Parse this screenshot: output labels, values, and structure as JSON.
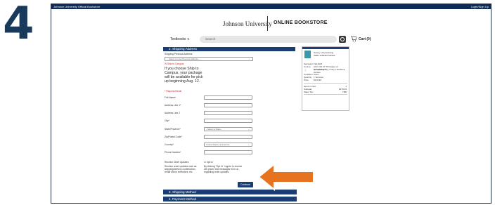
{
  "step_number": "4",
  "topbar": {
    "left": "Johnson University Official Bookstore",
    "right": "Login/Sign Up"
  },
  "header": {
    "university": "Johnson University",
    "store": "ONLINE BOOKSTORE"
  },
  "nav": {
    "textbooks": "Textbooks",
    "search_placeholder": "Search",
    "cart": "Cart (0)"
  },
  "shipping": {
    "heading": "2. Shipping Address",
    "prev_label": "Shipping Previous Address",
    "prev_select": "-- Select to Use Previous Address --",
    "ship_to_campus": "Ship to Campus",
    "campus_note": "If you choose Ship to Campus, your package will be available for pick up beginning Aug. 12.",
    "required": "* Required fields",
    "fields": [
      {
        "label": "Full Name*",
        "value": ""
      },
      {
        "label": "Address Line 1*",
        "value": ""
      },
      {
        "label": "Address Line 2",
        "value": ""
      },
      {
        "label": "City*",
        "value": ""
      },
      {
        "label": "State/Province*",
        "value": "--Select a State--"
      },
      {
        "label": "Zip/Postal Code*",
        "value": ""
      },
      {
        "label": "Country*",
        "value": "United States of America"
      },
      {
        "label": "Phone Number*",
        "value": ""
      }
    ],
    "updates_label": "Receive Order Updates",
    "updates_desc": "Receive order updates such as shipping/delivery confirmation, rental return reminders, etc.",
    "optin": "Opt-in",
    "optin_desc": "By clicking \"Opt In\" I agree to receive cell phone text messages from us regarding order updates.",
    "continue": "Continue"
  },
  "sections": [
    "3. Shipping Method",
    "4. Payment Method"
  ],
  "summary": {
    "book_title": "Survey of Accounting",
    "isbn": "ISBN: 9780357722930",
    "semester_label": "Semester",
    "semester": "Fall 2021",
    "course_label": "Course",
    "course": "ACC 201 47 \"Principles of Accounting I\"",
    "option": "Complementary 7 Day eTextbook Access",
    "condition_label": "Condition",
    "condition": "Used",
    "quantity_label": "Quantity",
    "quantity": "1 Services",
    "price_label": "Price",
    "price": "$179.99",
    "items_label": "Items in Cart:",
    "items": "1",
    "subtotal_label": "Subtotal:",
    "subtotal": "$179.99",
    "tax_label": "Sales Tax:",
    "tax": "TBD"
  }
}
